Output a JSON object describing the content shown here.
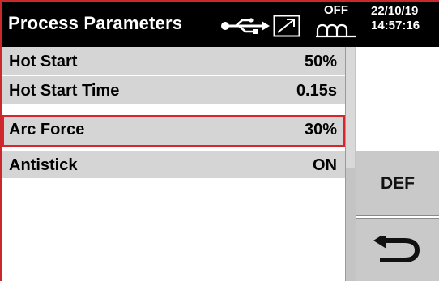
{
  "header": {
    "title": "Process Parameters",
    "status_off": "OFF",
    "date": "22/10/19",
    "time": "14:57:16",
    "icons": [
      "usb-icon",
      "trend-icon",
      "wave-icon"
    ]
  },
  "parameters": [
    {
      "label": "Hot Start",
      "value": "50%"
    },
    {
      "label": "Hot Start Time",
      "value": "0.15s"
    },
    {
      "label": "Arc Force",
      "value": "30%",
      "selected": true
    },
    {
      "label": "Antistick",
      "value": "ON"
    }
  ],
  "buttons": {
    "def_label": "DEF",
    "back_icon": "return-arrow-icon"
  },
  "colors": {
    "header_bg": "#000000",
    "row_bg": "#d5d5d5",
    "selection_border": "#d8252b",
    "button_bg": "#c9c9c9"
  }
}
